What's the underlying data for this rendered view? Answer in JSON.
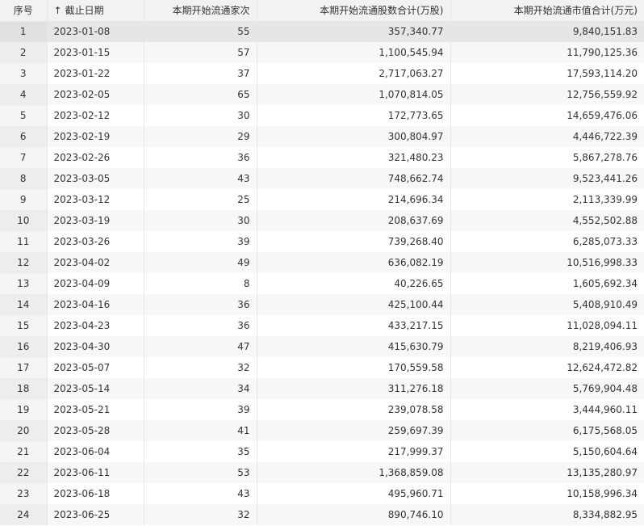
{
  "columns": {
    "index": "序号",
    "sort_arrow": "↑",
    "date": "截止日期",
    "count": "本期开始流通家次",
    "shares": "本期开始流通股数合计(万股)",
    "value": "本期开始流通市值合计(万元)"
  },
  "rows": [
    {
      "index": "1",
      "date": "2023-01-08",
      "count": "55",
      "shares": "357,340.77",
      "value": "9,840,151.83"
    },
    {
      "index": "2",
      "date": "2023-01-15",
      "count": "57",
      "shares": "1,100,545.94",
      "value": "11,790,125.36"
    },
    {
      "index": "3",
      "date": "2023-01-22",
      "count": "37",
      "shares": "2,717,063.27",
      "value": "17,593,114.20"
    },
    {
      "index": "4",
      "date": "2023-02-05",
      "count": "65",
      "shares": "1,070,814.05",
      "value": "12,756,559.92"
    },
    {
      "index": "5",
      "date": "2023-02-12",
      "count": "30",
      "shares": "172,773.65",
      "value": "14,659,476.06"
    },
    {
      "index": "6",
      "date": "2023-02-19",
      "count": "29",
      "shares": "300,804.97",
      "value": "4,446,722.39"
    },
    {
      "index": "7",
      "date": "2023-02-26",
      "count": "36",
      "shares": "321,480.23",
      "value": "5,867,278.76"
    },
    {
      "index": "8",
      "date": "2023-03-05",
      "count": "43",
      "shares": "748,662.74",
      "value": "9,523,441.26"
    },
    {
      "index": "9",
      "date": "2023-03-12",
      "count": "25",
      "shares": "214,696.34",
      "value": "2,113,339.99"
    },
    {
      "index": "10",
      "date": "2023-03-19",
      "count": "30",
      "shares": "208,637.69",
      "value": "4,552,502.88"
    },
    {
      "index": "11",
      "date": "2023-03-26",
      "count": "39",
      "shares": "739,268.40",
      "value": "6,285,073.33"
    },
    {
      "index": "12",
      "date": "2023-04-02",
      "count": "49",
      "shares": "636,082.19",
      "value": "10,516,998.33"
    },
    {
      "index": "13",
      "date": "2023-04-09",
      "count": "8",
      "shares": "40,226.65",
      "value": "1,605,692.34"
    },
    {
      "index": "14",
      "date": "2023-04-16",
      "count": "36",
      "shares": "425,100.44",
      "value": "5,408,910.49"
    },
    {
      "index": "15",
      "date": "2023-04-23",
      "count": "36",
      "shares": "433,217.15",
      "value": "11,028,094.11"
    },
    {
      "index": "16",
      "date": "2023-04-30",
      "count": "47",
      "shares": "415,630.79",
      "value": "8,219,406.93"
    },
    {
      "index": "17",
      "date": "2023-05-07",
      "count": "32",
      "shares": "170,559.58",
      "value": "12,624,472.82"
    },
    {
      "index": "18",
      "date": "2023-05-14",
      "count": "34",
      "shares": "311,276.18",
      "value": "5,769,904.48"
    },
    {
      "index": "19",
      "date": "2023-05-21",
      "count": "39",
      "shares": "239,078.58",
      "value": "3,444,960.11"
    },
    {
      "index": "20",
      "date": "2023-05-28",
      "count": "41",
      "shares": "259,697.39",
      "value": "6,175,568.05"
    },
    {
      "index": "21",
      "date": "2023-06-04",
      "count": "35",
      "shares": "217,999.37",
      "value": "5,150,604.64"
    },
    {
      "index": "22",
      "date": "2023-06-11",
      "count": "53",
      "shares": "1,368,859.08",
      "value": "13,135,280.97"
    },
    {
      "index": "23",
      "date": "2023-06-18",
      "count": "43",
      "shares": "495,960.71",
      "value": "10,158,996.34"
    },
    {
      "index": "24",
      "date": "2023-06-25",
      "count": "32",
      "shares": "890,746.10",
      "value": "8,334,882.95"
    }
  ]
}
